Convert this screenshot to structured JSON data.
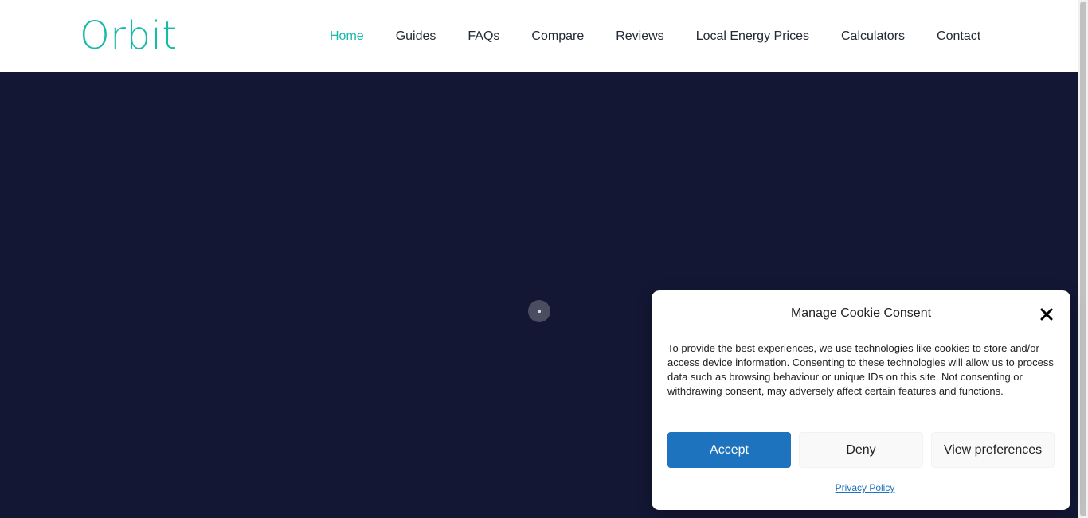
{
  "header": {
    "logo": "Orbit",
    "nav": [
      {
        "label": "Home",
        "active": true
      },
      {
        "label": "Guides",
        "active": false
      },
      {
        "label": "FAQs",
        "active": false
      },
      {
        "label": "Compare",
        "active": false
      },
      {
        "label": "Reviews",
        "active": false
      },
      {
        "label": "Local Energy Prices",
        "active": false
      },
      {
        "label": "Calculators",
        "active": false
      },
      {
        "label": "Contact",
        "active": false
      }
    ]
  },
  "hero": {
    "loader_icon": "loading-spinner-icon"
  },
  "cookie_banner": {
    "title": "Manage Cookie Consent",
    "close_icon": "close-icon",
    "text": "To provide the best experiences, we use technologies like cookies to store and/or access device information. Consenting to these technologies will allow us to process data such as browsing behaviour or unique IDs on this site. Not consenting or withdrawing consent, may adversely affect certain features and functions.",
    "accept_label": "Accept",
    "deny_label": "Deny",
    "preferences_label": "View preferences",
    "privacy_link": "Privacy Policy"
  },
  "colors": {
    "brand": "#17b9a7",
    "hero_background": "#141733",
    "accept_button": "#1e73be"
  }
}
